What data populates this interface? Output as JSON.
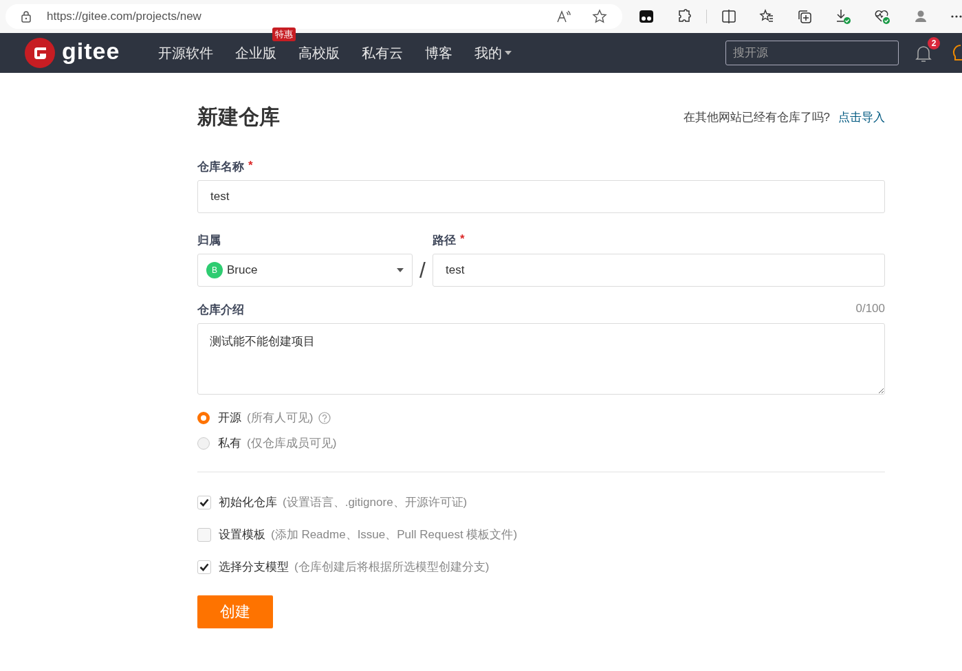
{
  "browser": {
    "url": "https://gitee.com/projects/new"
  },
  "nav": {
    "logo": "gitee",
    "items": [
      {
        "label": "开源软件",
        "has_menu": false
      },
      {
        "label": "企业版",
        "badge": "特惠",
        "has_menu": false
      },
      {
        "label": "高校版",
        "has_menu": false
      },
      {
        "label": "私有云",
        "has_menu": false
      },
      {
        "label": "博客",
        "has_menu": false
      },
      {
        "label": "我的",
        "has_menu": true
      }
    ],
    "search": {
      "placeholder": "搜开源"
    },
    "notification_count": "2"
  },
  "page": {
    "title": "新建仓库",
    "import_prompt": "在其他网站已经有仓库了吗?",
    "import_link": "点击导入"
  },
  "form": {
    "name": {
      "label": "仓库名称",
      "required_mark": "*",
      "value": "test"
    },
    "owner": {
      "label": "归属",
      "avatar_letter": "B",
      "value": "Bruce"
    },
    "separator": "/",
    "path": {
      "label": "路径",
      "required_mark": "*",
      "value": "test"
    },
    "description": {
      "label": "仓库介绍",
      "counter": "0/100",
      "value": "测试能不能创建项目"
    },
    "visibility": [
      {
        "label": "开源",
        "hint": "(所有人可见)",
        "help": true,
        "selected": true
      },
      {
        "label": "私有",
        "hint": "(仅仓库成员可见)",
        "help": false,
        "selected": false
      }
    ],
    "options": [
      {
        "label": "初始化仓库",
        "hint": "(设置语言、.gitignore、开源许可证)",
        "checked": true
      },
      {
        "label": "设置模板",
        "hint": "(添加 Readme、Issue、Pull Request 模板文件)",
        "checked": false
      },
      {
        "label": "选择分支模型",
        "hint": "(仓库创建后将根据所选模型创建分支)",
        "checked": true
      }
    ],
    "submit": "创建"
  }
}
